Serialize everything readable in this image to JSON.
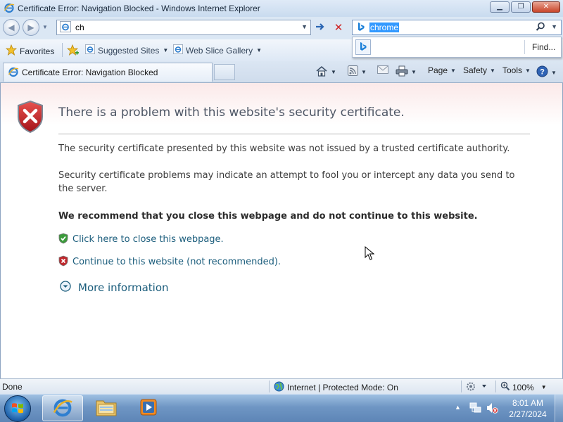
{
  "window": {
    "title": "Certificate Error: Navigation Blocked - Windows Internet Explorer"
  },
  "address_bar": {
    "value": "ch"
  },
  "search": {
    "value": "chrome",
    "find_label": "Find..."
  },
  "favorites_bar": {
    "favorites_label": "Favorites",
    "suggested_sites_label": "Suggested Sites",
    "web_slice_label": "Web Slice Gallery"
  },
  "tabs": [
    {
      "label": "Certificate Error: Navigation Blocked",
      "active": true
    }
  ],
  "command_bar": {
    "page_label": "Page",
    "safety_label": "Safety",
    "tools_label": "Tools"
  },
  "content": {
    "title": "There is a problem with this website's security certificate.",
    "message_1": "The security certificate presented by this website was not issued by a trusted certificate authority.",
    "message_2": "Security certificate problems may indicate an attempt to fool you or intercept any data you send to the server.",
    "recommendation": "We recommend that you close this webpage and do not continue to this website.",
    "close_link": "Click here to close this webpage.",
    "continue_link": "Continue to this website (not recommended).",
    "more_info_link": "More information"
  },
  "status_bar": {
    "status": "Done",
    "zone": "Internet | Protected Mode: On",
    "zoom": "100%"
  },
  "taskbar": {
    "time": "8:01 AM",
    "date": "2/27/2024"
  },
  "colors": {
    "link": "#1b5d7c",
    "error_red": "#c0282d",
    "ok_green": "#3b9b3b",
    "selection_blue": "#3399ff"
  }
}
